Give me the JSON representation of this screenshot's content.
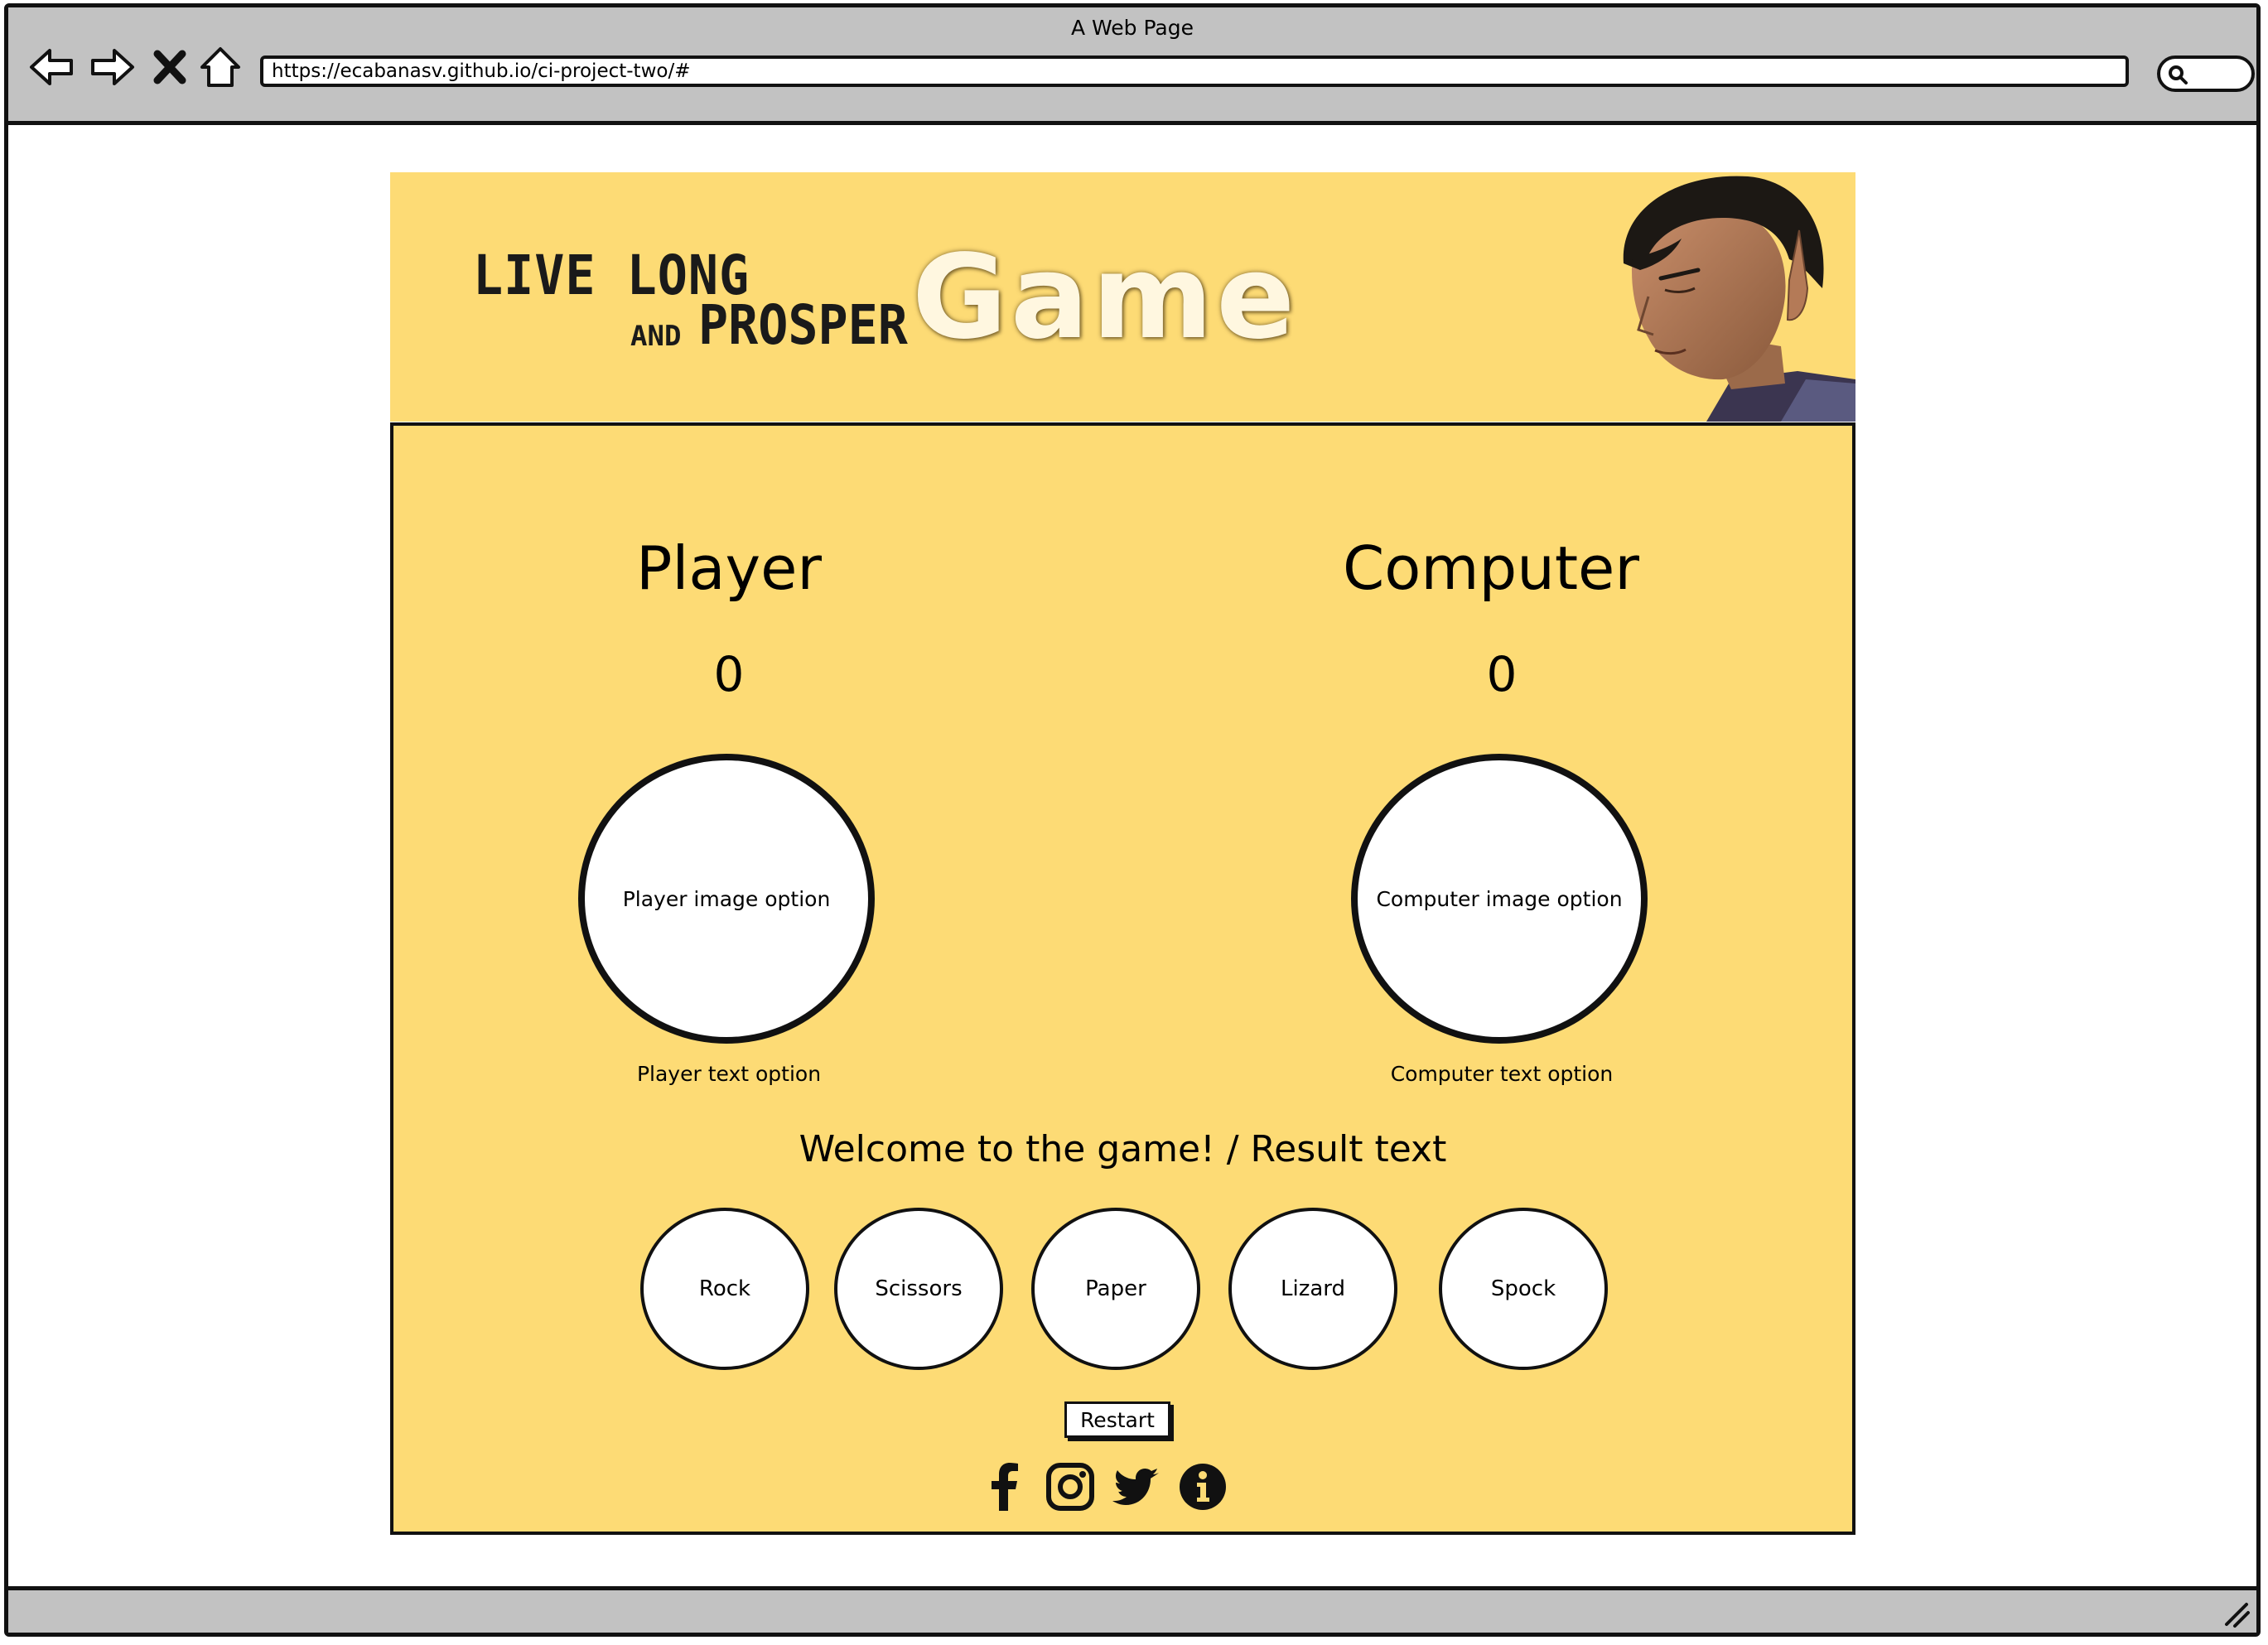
{
  "window": {
    "title": "A Web Page"
  },
  "browser": {
    "url": "https://ecabanasv.github.io/ci-project-two/#",
    "back_icon": "back-arrow-icon",
    "forward_icon": "forward-arrow-icon",
    "stop_icon": "close-icon",
    "home_icon": "home-icon",
    "search_icon": "search-icon"
  },
  "banner": {
    "logo_line1": "LIVE LONG",
    "logo_and": "AND",
    "logo_line2": "PROSPER",
    "logo_game": "Game",
    "portrait_icon": "spock-portrait-image"
  },
  "game": {
    "player": {
      "title": "Player",
      "score": "0",
      "image_label": "Player image option",
      "text_label": "Player text option"
    },
    "computer": {
      "title": "Computer",
      "score": "0",
      "image_label": "Computer image option",
      "text_label": "Computer text option"
    },
    "result_text": "Welcome to the game! / Result text",
    "options": [
      "Rock",
      "Scissors",
      "Paper",
      "Lizard",
      "Spock"
    ],
    "restart_label": "Restart"
  },
  "footer": {
    "icons": [
      "facebook-icon",
      "instagram-icon",
      "twitter-icon",
      "info-icon"
    ]
  },
  "colors": {
    "panel": "#fddb75",
    "chrome": "#c2c2c2",
    "border": "#111111"
  }
}
